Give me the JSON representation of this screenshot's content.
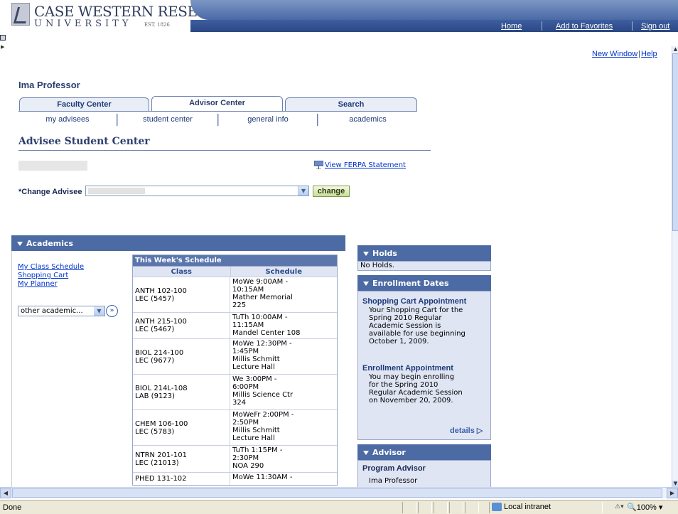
{
  "header": {
    "logo_line1": "CASE WESTERN RESERVE",
    "logo_line2": "UNIVERSITY",
    "logo_est": "EST. 1826",
    "links": [
      "Home",
      "Add to Favorites",
      "Sign out"
    ]
  },
  "util_links": {
    "new_window": "New Window",
    "sep": "|",
    "help": "Help"
  },
  "person_name": "Ima Professor",
  "tabs": [
    "Faculty Center",
    "Advisor Center",
    "Search"
  ],
  "subtabs": [
    "my advisees",
    "student center",
    "general info",
    "academics"
  ],
  "page_title": "Advisee Student Center",
  "ferpa_link": "View FERPA Statement",
  "change_advisee": {
    "label": "*Change Advisee",
    "button": "change"
  },
  "academics": {
    "title": "Academics",
    "links": [
      "My Class Schedule",
      "Shopping Cart",
      "My Planner"
    ],
    "other_select": "other academic..."
  },
  "schedule": {
    "title": "This Week's Schedule",
    "col_class": "Class",
    "col_schedule": "Schedule",
    "rows": [
      {
        "class1": "ANTH 102-100",
        "class2": "LEC (5457)",
        "sched": [
          "MoWe 9:00AM -",
          "10:15AM",
          "Mather Memorial",
          "225"
        ]
      },
      {
        "class1": "ANTH 215-100",
        "class2": "LEC (5467)",
        "sched": [
          "TuTh 10:00AM -",
          "11:15AM",
          "Mandel Center 108"
        ]
      },
      {
        "class1": "BIOL 214-100",
        "class2": "LEC (9677)",
        "sched": [
          "MoWe 12:30PM -",
          "1:45PM",
          "Millis Schmitt",
          "Lecture Hall"
        ]
      },
      {
        "class1": "BIOL 214L-108",
        "class2": "LAB (9123)",
        "sched": [
          "We 3:00PM -",
          "6:00PM",
          "Millis Science Ctr",
          "324"
        ]
      },
      {
        "class1": "CHEM 106-100",
        "class2": "LEC (5783)",
        "sched": [
          "MoWeFr 2:00PM -",
          "2:50PM",
          "Millis Schmitt",
          "Lecture Hall"
        ]
      },
      {
        "class1": "NTRN 201-101",
        "class2": "LEC (21013)",
        "sched": [
          "TuTh 1:15PM -",
          "2:30PM",
          "NOA 290"
        ]
      },
      {
        "class1": "PHED 131-102",
        "class2": "",
        "sched": [
          "MoWe 11:30AM -"
        ]
      }
    ]
  },
  "holds": {
    "title": "Holds",
    "text": "No Holds."
  },
  "enrollment": {
    "title": "Enrollment Dates",
    "cart_title": "Shopping Cart Appointment",
    "cart_text": [
      "Your Shopping Cart for the",
      "Spring 2010 Regular",
      "Academic Session is",
      "available for use beginning",
      "October 1, 2009."
    ],
    "enroll_title": "Enrollment Appointment",
    "enroll_text": [
      "You may begin enrolling",
      "for the Spring 2010",
      "Regular Academic Session",
      "on November 20, 2009."
    ],
    "details": "details"
  },
  "advisor": {
    "title": "Advisor",
    "program_title": "Program Advisor",
    "name": "Ima Professor"
  },
  "status": {
    "done": "Done",
    "zone": "Local intranet",
    "zoom": "100%"
  }
}
